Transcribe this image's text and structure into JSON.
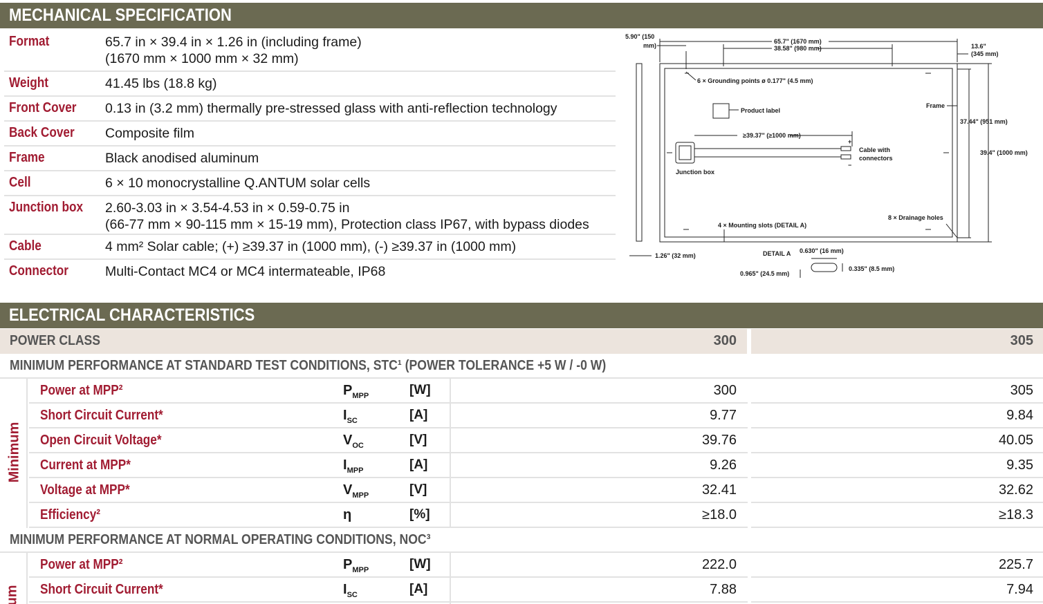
{
  "mechanical": {
    "title": "MECHANICAL SPECIFICATION",
    "rows": [
      {
        "label": "Format",
        "value": "65.7 in × 39.4 in × 1.26 in (including frame)",
        "value2": "(1670 mm × 1000 mm × 32 mm)"
      },
      {
        "label": "Weight",
        "value": "41.45 lbs (18.8 kg)"
      },
      {
        "label": "Front Cover",
        "value": "0.13 in (3.2 mm) thermally pre-stressed glass with anti-reflection technology"
      },
      {
        "label": "Back Cover",
        "value": "Composite film"
      },
      {
        "label": "Frame",
        "value": "Black anodised aluminum"
      },
      {
        "label": "Cell",
        "value": "6 × 10 monocrystalline Q.ANTUM solar cells"
      },
      {
        "label": "Junction box",
        "value": "2.60-3.03 in × 3.54-4.53 in × 0.59-0.75 in",
        "value2": "(66-77 mm × 90-115 mm × 15-19 mm), Protection class IP67, with bypass diodes"
      },
      {
        "label": "Cable",
        "value": "4 mm² Solar cable; (+) ≥39.37 in (1000 mm), (-) ≥39.37 in (1000 mm)"
      },
      {
        "label": "Connector",
        "value": "Multi-Contact MC4 or MC4 intermateable, IP68"
      }
    ]
  },
  "diagram": {
    "dim_edge": "5.90\" (150",
    "dim_edge2": "mm)",
    "dim_length": "65.7\" (1670 mm)",
    "dim_inner_length": "38.58\" (980 mm)",
    "dim_right_top": "13.6\"",
    "dim_right_top2": "(345 mm)",
    "grounding": "6 × Grounding points ø 0.177\" (4.5 mm)",
    "product_label": "Product label",
    "frame": "Frame",
    "dim_inner_height": "37.44\" (951 mm)",
    "dim_height": "39.4\" (1000 mm)",
    "cable_length": "≥39.37\" (≥1000 mm)",
    "cable_with": "Cable with",
    "connectors": "connectors",
    "junction_box": "Junction box",
    "mounting_slots": "4 × Mounting slots (DETAIL A)",
    "drainage": "8 × Drainage holes",
    "thickness": "1.26\" (32 mm)",
    "detail_a": "DETAIL A",
    "detail_w": "0.630\" (16 mm)",
    "detail_h": "0.335\" (8.5 mm)",
    "detail_len": "0.965\" (24.5 mm)",
    "plus": "+",
    "minus": "−"
  },
  "electrical": {
    "title": "ELECTRICAL CHARACTERISTICS",
    "power_class_label": "POWER CLASS",
    "power_classes": [
      "300",
      "305"
    ],
    "stc_heading": "MINIMUM PERFORMANCE AT STANDARD TEST CONDITIONS, STC¹ (POWER TOLERANCE +5 W / -0 W)",
    "stc_side_label": "Minimum",
    "stc_rows": [
      {
        "name": "Power at MPP²",
        "sym": "P",
        "sub": "MPP",
        "unit": "[W]",
        "v1": "300",
        "v2": "305"
      },
      {
        "name": "Short Circuit Current*",
        "sym": "I",
        "sub": "SC",
        "unit": "[A]",
        "v1": "9.77",
        "v2": "9.84"
      },
      {
        "name": "Open Circuit Voltage*",
        "sym": "V",
        "sub": "OC",
        "unit": "[V]",
        "v1": "39.76",
        "v2": "40.05"
      },
      {
        "name": "Current at MPP*",
        "sym": "I",
        "sub": "MPP",
        "unit": "[A]",
        "v1": "9.26",
        "v2": "9.35"
      },
      {
        "name": "Voltage at MPP*",
        "sym": "V",
        "sub": "MPP",
        "unit": "[V]",
        "v1": "32.41",
        "v2": "32.62"
      },
      {
        "name": "Efficiency²",
        "sym": "η",
        "sub": "",
        "unit": "[%]",
        "v1": "≥18.0",
        "v2": "≥18.3"
      }
    ],
    "noc_heading": "MINIMUM PERFORMANCE AT NORMAL OPERATING CONDITIONS, NOC³",
    "noc_side_label": "um",
    "noc_rows": [
      {
        "name": "Power at MPP²",
        "sym": "P",
        "sub": "MPP",
        "unit": "[W]",
        "v1": "222.0",
        "v2": "225.7"
      },
      {
        "name": "Short Circuit Current*",
        "sym": "I",
        "sub": "SC",
        "unit": "[A]",
        "v1": "7.88",
        "v2": "7.94"
      }
    ]
  }
}
